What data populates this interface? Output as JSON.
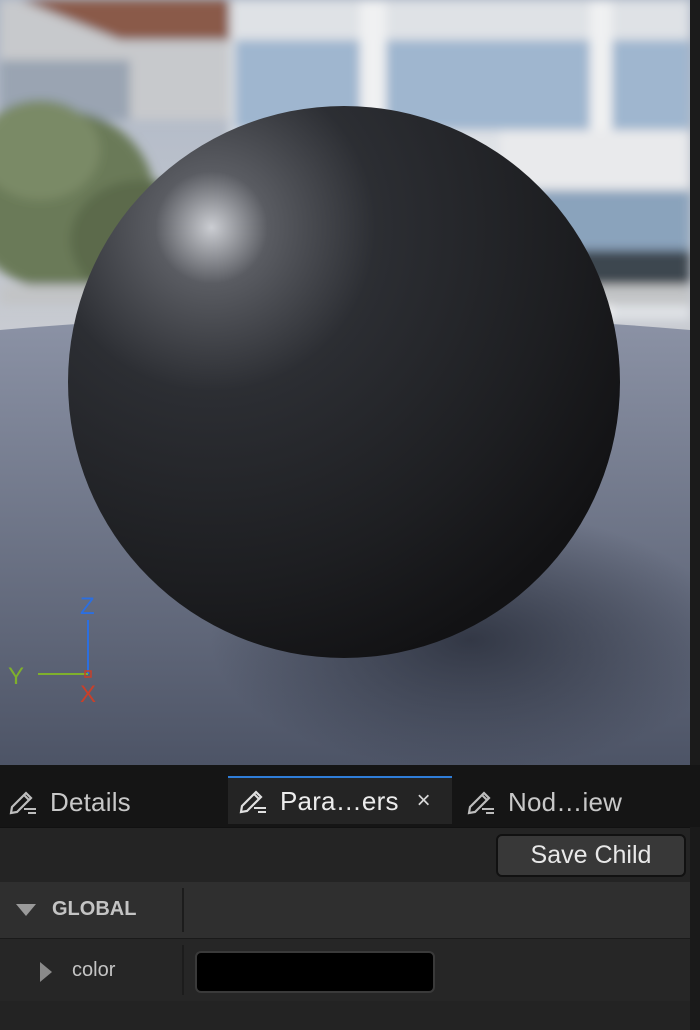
{
  "tabs": [
    {
      "label": "Details",
      "icon": "pencil-icon",
      "active": false
    },
    {
      "label": "Para…ers",
      "icon": "pencil-icon",
      "active": true,
      "close": "×"
    },
    {
      "label": "Nod…iew",
      "icon": "pencil-icon",
      "active": false
    }
  ],
  "toolbar": {
    "save_child_label": "Save Child"
  },
  "params": {
    "category": {
      "label": "GLOBAL",
      "expanded": true
    },
    "properties": [
      {
        "label": "color",
        "value_color": "#000000",
        "expanded": false
      }
    ]
  },
  "viewport": {
    "axes": {
      "z": "Z",
      "y": "Y",
      "x": "X"
    },
    "colors": {
      "z": "#2c6fe0",
      "y": "#7fb02c",
      "x": "#c8402a"
    }
  },
  "colors": {
    "accent": "#2f7dd8",
    "panel_bg": "#242424"
  }
}
